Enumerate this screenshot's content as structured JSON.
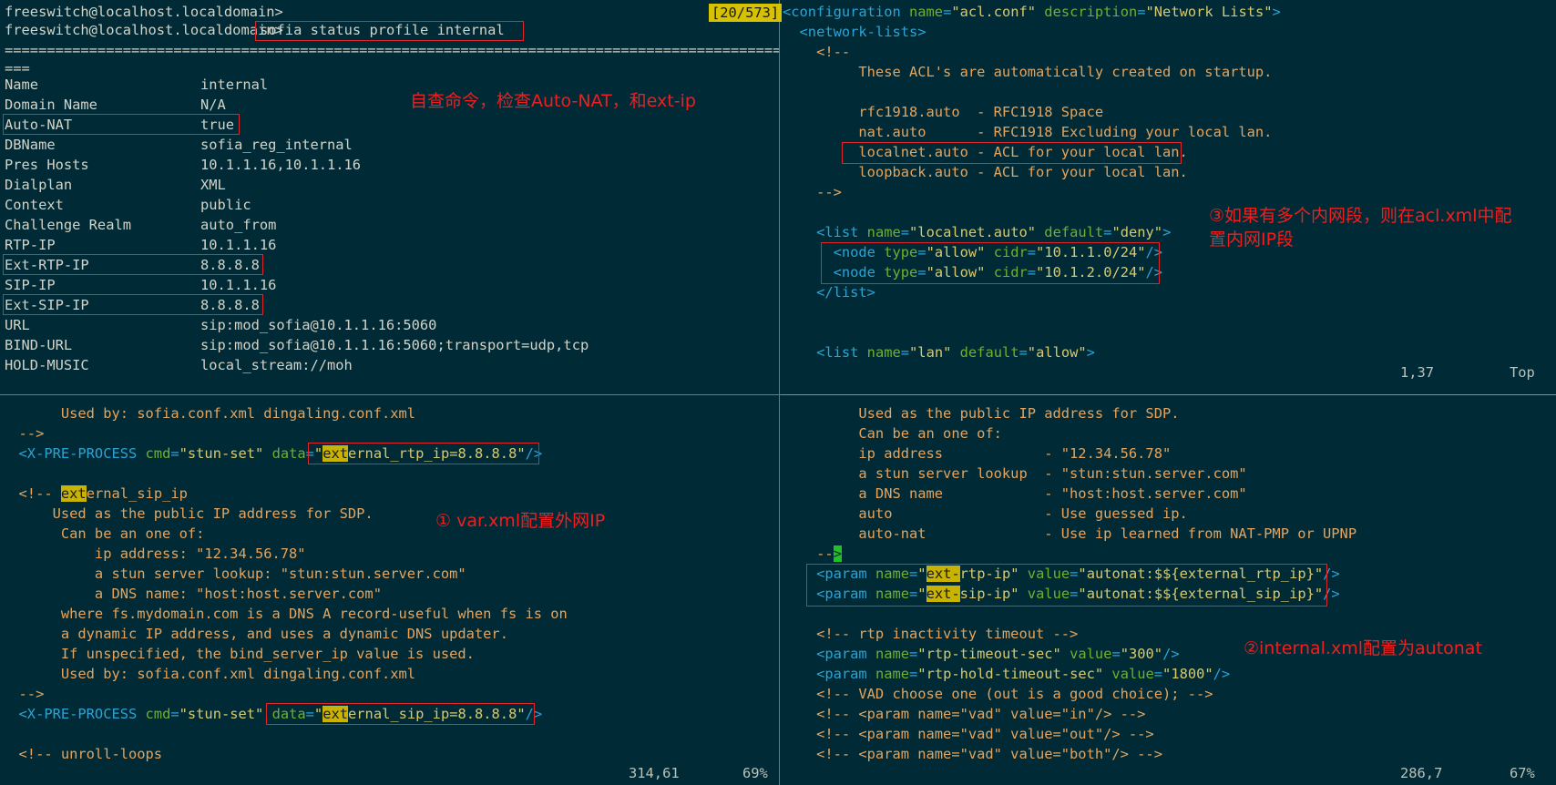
{
  "top_left": {
    "prompt1": "freeswitch@localhost.localdomain>",
    "prompt2": "freeswitch@localhost.localdomain>",
    "command": "sofia status profile internal",
    "counter": "[20/573]",
    "rule1": "============================================================================================",
    "rule2": "===",
    "rows": [
      {
        "key": "Name",
        "value": "internal"
      },
      {
        "key": "Domain Name",
        "value": "N/A"
      },
      {
        "key": "Auto-NAT",
        "value": "true"
      },
      {
        "key": "DBName",
        "value": "sofia_reg_internal"
      },
      {
        "key": "Pres Hosts",
        "value": "10.1.1.16,10.1.1.16"
      },
      {
        "key": "Dialplan",
        "value": "XML"
      },
      {
        "key": "Context",
        "value": "public"
      },
      {
        "key": "Challenge Realm",
        "value": "auto_from"
      },
      {
        "key": "RTP-IP",
        "value": "10.1.1.16"
      },
      {
        "key": "Ext-RTP-IP",
        "value": "8.8.8.8"
      },
      {
        "key": "SIP-IP",
        "value": "10.1.1.16"
      },
      {
        "key": "Ext-SIP-IP",
        "value": "8.8.8.8"
      },
      {
        "key": "URL",
        "value": "sip:mod_sofia@10.1.1.16:5060"
      },
      {
        "key": "BIND-URL",
        "value": "sip:mod_sofia@10.1.1.16:5060;transport=udp,tcp"
      },
      {
        "key": "HOLD-MUSIC",
        "value": "local_stream://moh"
      }
    ],
    "annotation": "自查命令，检查Auto-NAT，和ext-ip"
  },
  "top_right": {
    "lines": {
      "l1a": "<configuration ",
      "l1b": "name",
      "l1c": "=",
      "l1d": "\"acl.conf\"",
      "l1e": " description",
      "l1f": "=",
      "l1g": "\"Network Lists\"",
      "l1h": ">",
      "l2": "  <network-lists>",
      "l3": "    <!--",
      "l4": "         These ACL's are automatically created on startup.",
      "l5": "",
      "l6": "         rfc1918.auto  - RFC1918 Space",
      "l7": "         nat.auto      - RFC1918 Excluding your local lan.",
      "l8": "         localnet.auto - ACL for your local lan.",
      "l9": "         loopback.auto - ACL for your local lan.",
      "l10": "    -->",
      "l12a": "    <list ",
      "l12b": "name",
      "l12c": "=",
      "l12d": "\"localnet.auto\"",
      "l12e": " default",
      "l12f": "=",
      "l12g": "\"deny\"",
      "l12h": ">",
      "l13a": "      <node ",
      "l13b": "type",
      "l13c": "=",
      "l13d": "\"allow\"",
      "l13e": " cidr",
      "l13f": "=",
      "l13g": "\"10.1.1.0/24\"",
      "l13h": "/>",
      "l14a": "      <node ",
      "l14b": "type",
      "l14c": "=",
      "l14d": "\"allow\"",
      "l14e": " cidr",
      "l14f": "=",
      "l14g": "\"10.1.2.0/24\"",
      "l14h": "/>",
      "l15": "    </list>",
      "l18a": "    <list ",
      "l18b": "name",
      "l18c": "=",
      "l18d": "\"lan\"",
      "l18e": " default",
      "l18f": "=",
      "l18g": "\"allow\"",
      "l18h": ">"
    },
    "status_pos": "1,37",
    "status_pct": "Top",
    "annotation_line1": "③如果有多个内网段，则在acl.xml中配",
    "annotation_line2": "置内网IP段"
  },
  "bottom_left": {
    "lines": {
      "l1": "       Used by: sofia.conf.xml dingaling.conf.xml",
      "l2": "  -->",
      "l3a": "  <X-PRE-PROCESS ",
      "l3b": "cmd",
      "l3c": "=",
      "l3d": "\"stun-set\"",
      "l3e": " data",
      "l3f": "=",
      "l3g": "\"",
      "l3h": "ext",
      "l3i": "ernal_rtp_ip=8.8.8.8\"",
      "l3j": "/>",
      "l5a": "  <!-- ",
      "l5b": "ext",
      "l5c": "ernal_sip_ip",
      "l6": "      Used as the public IP address for SDP.",
      "l7": "       Can be an one of:",
      "l8": "           ip address: \"12.34.56.78\"",
      "l9": "           a stun server lookup: \"stun:stun.server.com\"",
      "l10": "           a DNS name: \"host:host.server.com\"",
      "l11": "       where fs.mydomain.com is a DNS A record-useful when fs is on",
      "l12": "       a dynamic IP address, and uses a dynamic DNS updater.",
      "l13": "       If unspecified, the bind_server_ip value is used.",
      "l14": "       Used by: sofia.conf.xml dingaling.conf.xml",
      "l15": "  -->",
      "l16a": "  <X-PRE-PROCESS ",
      "l16b": "cmd",
      "l16c": "=",
      "l16d": "\"stun-set\"",
      "l16e": " data",
      "l16f": "=",
      "l16g": "\"",
      "l16h": "ext",
      "l16i": "ernal_sip_ip=8.8.8.8\"",
      "l16j": "/>",
      "l18": "  <!-- unroll-loops"
    },
    "status_pos": "314,61",
    "status_pct": "69%",
    "annotation": "① var.xml配置外网IP"
  },
  "bottom_right": {
    "lines": {
      "l1": "         Used as the public IP address for SDP.",
      "l2": "         Can be an one of:",
      "l3": "         ip address            - \"12.34.56.78\"",
      "l4": "         a stun server lookup  - \"stun:stun.server.com\"",
      "l5": "         a DNS name            - \"host:host.server.com\"",
      "l6": "         auto                  - Use guessed ip.",
      "l7": "         auto-nat              - Use ip learned from NAT-PMP or UPNP",
      "l8a": "    --",
      "l8b": ">",
      "l9a": "    <param ",
      "l9b": "name",
      "l9c": "=",
      "l9d": "\"",
      "l9e": "ext-",
      "l9f": "rtp-ip\"",
      "l9g": " value",
      "l9h": "=",
      "l9i": "\"autonat:$${external_rtp_ip}\"",
      "l9j": "/>",
      "l10a": "    <param ",
      "l10b": "name",
      "l10c": "=",
      "l10d": "\"",
      "l10e": "ext-",
      "l10f": "sip-ip\"",
      "l10g": " value",
      "l10h": "=",
      "l10i": "\"autonat:$${external_sip_ip}\"",
      "l10j": "/>",
      "l12": "    <!-- rtp inactivity timeout -->",
      "l13a": "    <param ",
      "l13b": "name",
      "l13c": "=",
      "l13d": "\"rtp-timeout-sec\"",
      "l13e": " value",
      "l13f": "=",
      "l13g": "\"300\"",
      "l13h": "/>",
      "l14a": "    <param ",
      "l14b": "name",
      "l14c": "=",
      "l14d": "\"rtp-hold-timeout-sec\"",
      "l14e": " value",
      "l14f": "=",
      "l14g": "\"1800\"",
      "l14h": "/>",
      "l15": "    <!-- VAD choose one (out is a good choice); -->",
      "l16": "    <!-- <param name=\"vad\" value=\"in\"/> -->",
      "l17": "    <!-- <param name=\"vad\" value=\"out\"/> -->",
      "l18": "    <!-- <param name=\"vad\" value=\"both\"/> -->"
    },
    "status_pos": "286,7",
    "status_pct": "67%",
    "annotation": "②internal.xml配置为autonat"
  },
  "colors": {
    "background": "#002b36",
    "annotation_red": "#f01e1e",
    "search_highlight": "#c8b400",
    "cursor": "#22c022"
  }
}
